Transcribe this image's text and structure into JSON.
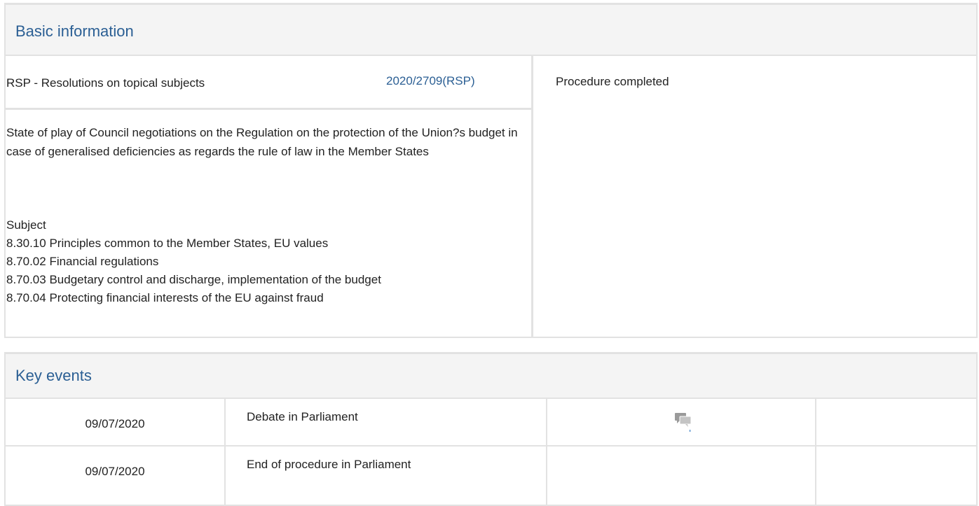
{
  "basic": {
    "title": "Basic information",
    "procedure_type": "RSP - Resolutions on topical subjects",
    "reference": "2020/2709(RSP)",
    "status": "Procedure completed",
    "procedure_title": "State of play of Council negotiations on the Regulation on the protection of the Union?s budget in case of generalised deficiencies as regards the rule of law in the Member States",
    "subject_label": "Subject",
    "subjects": [
      "8.30.10 Principles common to the Member States, EU values",
      "8.70.02 Financial regulations",
      "8.70.03 Budgetary control and discharge, implementation of the budget",
      "8.70.04 Protecting financial interests of the EU against fraud"
    ]
  },
  "key_events": {
    "title": "Key events",
    "rows": [
      {
        "date": "09/07/2020",
        "description": "Debate in Parliament",
        "icon": "debate-icon"
      },
      {
        "date": "09/07/2020",
        "description": "End of procedure in Parliament",
        "icon": ""
      }
    ]
  },
  "colors": {
    "accent": "#2b5f94",
    "header_bg": "#f4f4f4",
    "border": "#e2e2e2"
  }
}
